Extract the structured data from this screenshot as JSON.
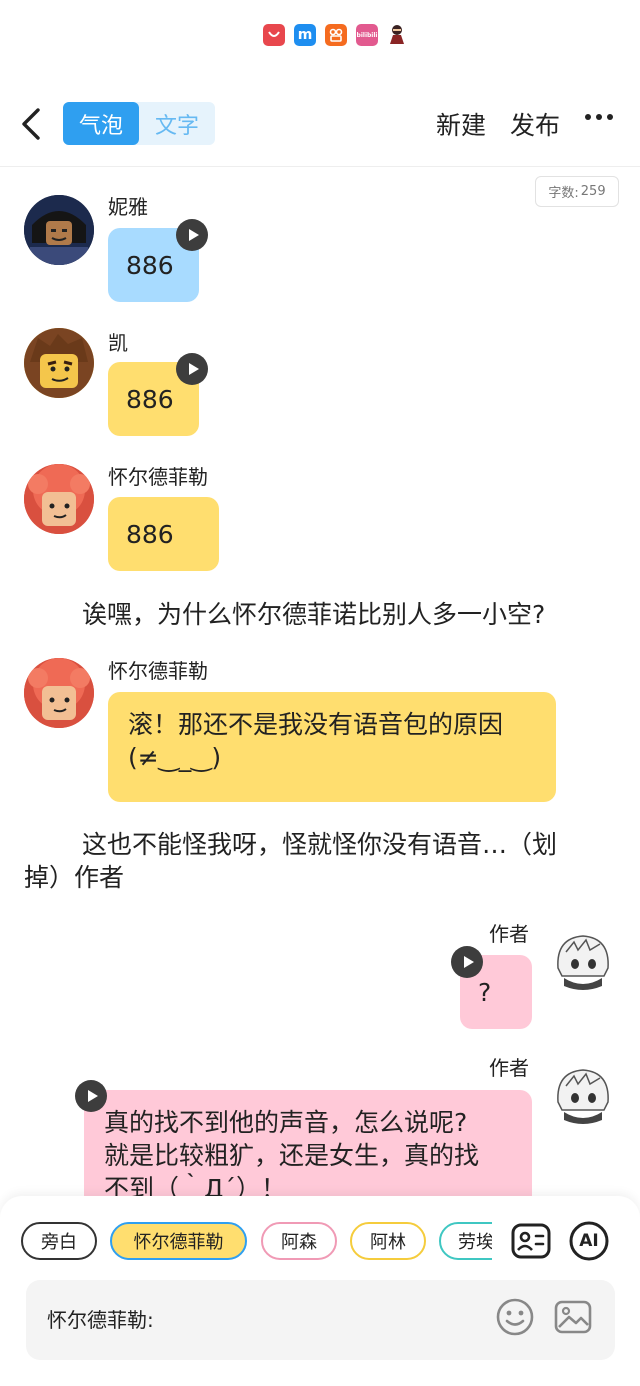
{
  "status_bar": {
    "apps": [
      {
        "icon": "huawei-appgallery-icon",
        "label": "HUAWEI",
        "color": "#e8474d"
      },
      {
        "icon": "meituan-m-icon",
        "label": "m",
        "color": "#1e8ef0"
      },
      {
        "icon": "kuaishou-icon",
        "label": "",
        "color": "#f56b1f"
      },
      {
        "icon": "bilibili-icon",
        "label": "bilibili",
        "color": "#e25a8f"
      },
      {
        "icon": "ninja-figure-icon",
        "label": "",
        "color": "#7a2b2b"
      }
    ]
  },
  "header": {
    "tabs": [
      {
        "label": "气泡"
      },
      {
        "label": "文字"
      }
    ],
    "new_label": "新建",
    "publish_label": "发布"
  },
  "word_count": {
    "label": "字数:",
    "value": "259"
  },
  "messages": [
    {
      "speaker": "妮雅",
      "text": "886",
      "voice": true,
      "color": "#a8dbff"
    },
    {
      "speaker": "凯",
      "text": "886",
      "voice": true,
      "color": "#ffde6f"
    },
    {
      "speaker": "怀尔德菲勒",
      "text": "886",
      "voice": false,
      "color": "#ffde6f"
    },
    {
      "narration": "诶嘿，为什么怀尔德菲诺比别人多一小空?"
    },
    {
      "speaker": "怀尔德菲勒",
      "text_lines": [
        "滚！那还不是我没有语音包的原因",
        "(≠‿_‿)"
      ],
      "voice": false,
      "color": "#ffde6f"
    },
    {
      "narration_lines": [
        "这也不能怪我呀，怪就怪你没有语音…（划",
        "掉）作者"
      ]
    },
    {
      "speaker": "作者",
      "text": "?",
      "voice": true,
      "color": "#ffc9d8"
    },
    {
      "speaker": "作者",
      "text_lines": [
        "真的找不到他的声音，怎么说呢?",
        "就是比较粗犷，还是女生，真的找",
        "不到（｀Д´）！"
      ],
      "voice": true,
      "color": "#ffc9d8"
    }
  ],
  "roles": [
    {
      "label": "旁白",
      "border": "#333333",
      "fill": "#ffffff"
    },
    {
      "label": "怀尔德菲勒",
      "border": "#2f9ff0",
      "fill": "#ffde6f"
    },
    {
      "label": "阿森",
      "border": "#f09ab5",
      "fill": "#ffffff"
    },
    {
      "label": "阿林",
      "border": "#f5cc3c",
      "fill": "#ffffff"
    },
    {
      "label": "劳埃德",
      "border": "#3fc7c2",
      "fill": "#ffffff"
    }
  ],
  "input": {
    "prefix": "怀尔德菲勒:"
  },
  "tools": {
    "ai_label": "AI"
  }
}
